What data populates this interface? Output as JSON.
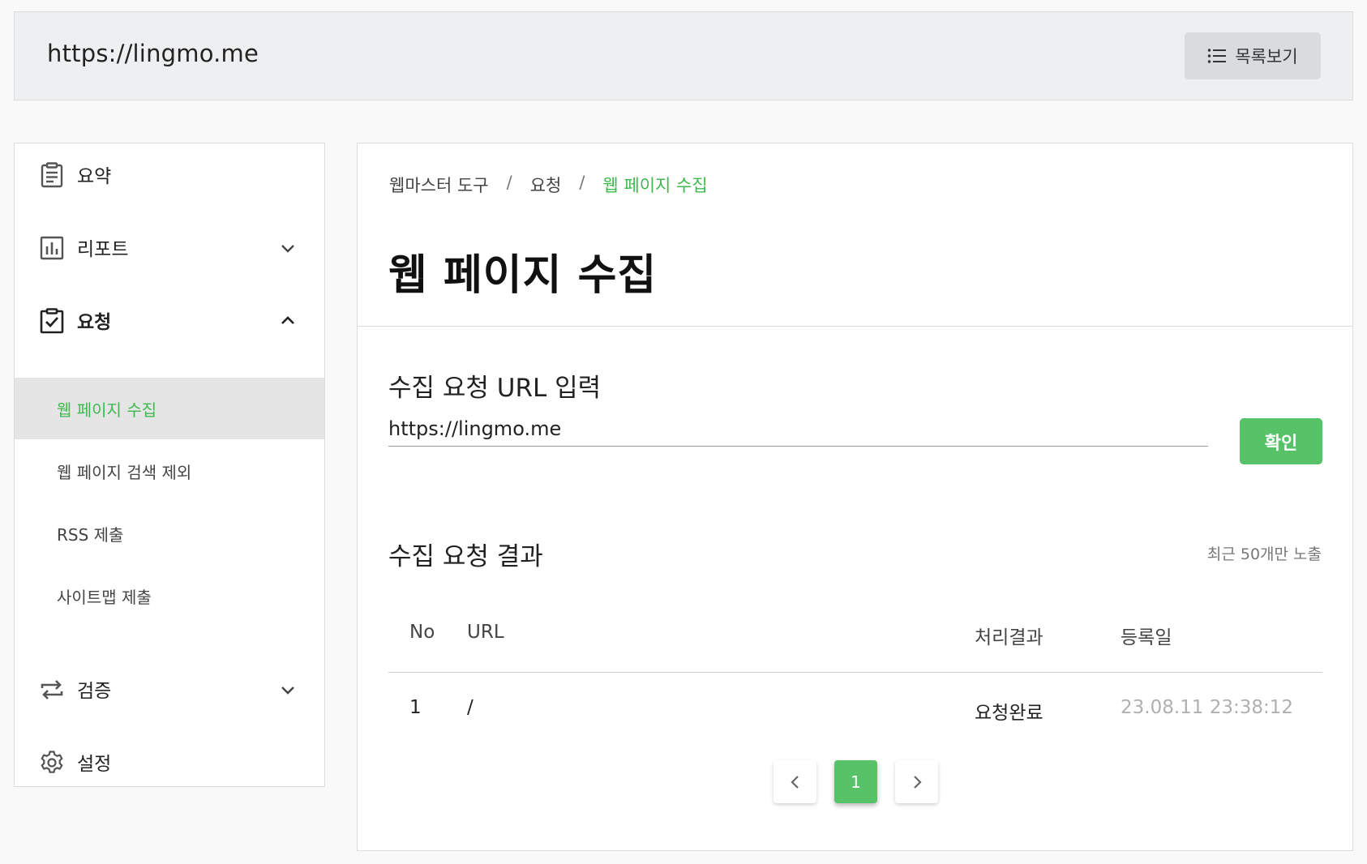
{
  "header": {
    "site_url": "https://lingmo.me",
    "list_button_label": "목록보기",
    "list_button_icon": "list-icon"
  },
  "sidebar": {
    "items": [
      {
        "label": "요약",
        "icon": "clipboard-list-icon",
        "chevron": null,
        "expanded": false
      },
      {
        "label": "리포트",
        "icon": "bar-chart-icon",
        "chevron": "chevron-down-icon",
        "expanded": false
      },
      {
        "label": "요청",
        "icon": "clipboard-check-icon",
        "chevron": "chevron-up-icon",
        "expanded": true
      },
      {
        "label": "검증",
        "icon": "repeat-icon",
        "chevron": "chevron-down-icon",
        "expanded": false
      },
      {
        "label": "설정",
        "icon": "gear-icon",
        "chevron": null,
        "expanded": false
      }
    ],
    "sub_items": [
      {
        "label": "웹 페이지 수집",
        "active": true
      },
      {
        "label": "웹 페이지 검색 제외",
        "active": false
      },
      {
        "label": "RSS 제출",
        "active": false
      },
      {
        "label": "사이트맵 제출",
        "active": false
      }
    ]
  },
  "main": {
    "breadcrumb": [
      "웹마스터 도구",
      "요청",
      "웹 페이지 수집"
    ],
    "breadcrumb_separator": "/",
    "title": "웹 페이지 수집",
    "url_section_title": "수집 요청 URL 입력",
    "url_input_value": "https://lingmo.me",
    "confirm_label": "확인",
    "result_section_title": "수집 요청 결과",
    "recent_note": "최근 50개만 노출",
    "table": {
      "headers": [
        "No",
        "URL",
        "처리결과",
        "등록일"
      ],
      "rows": [
        [
          "1",
          "/",
          "요청완료",
          "23.08.11 23:38:12"
        ]
      ]
    },
    "pagination": {
      "current_page": "1",
      "prev_icon": "chevron-left-icon",
      "next_icon": "chevron-right-icon"
    }
  },
  "colors": {
    "accent_green": "#58c268",
    "accent_text_green": "#3fb94f",
    "active_bg": "#e5e5e5"
  }
}
